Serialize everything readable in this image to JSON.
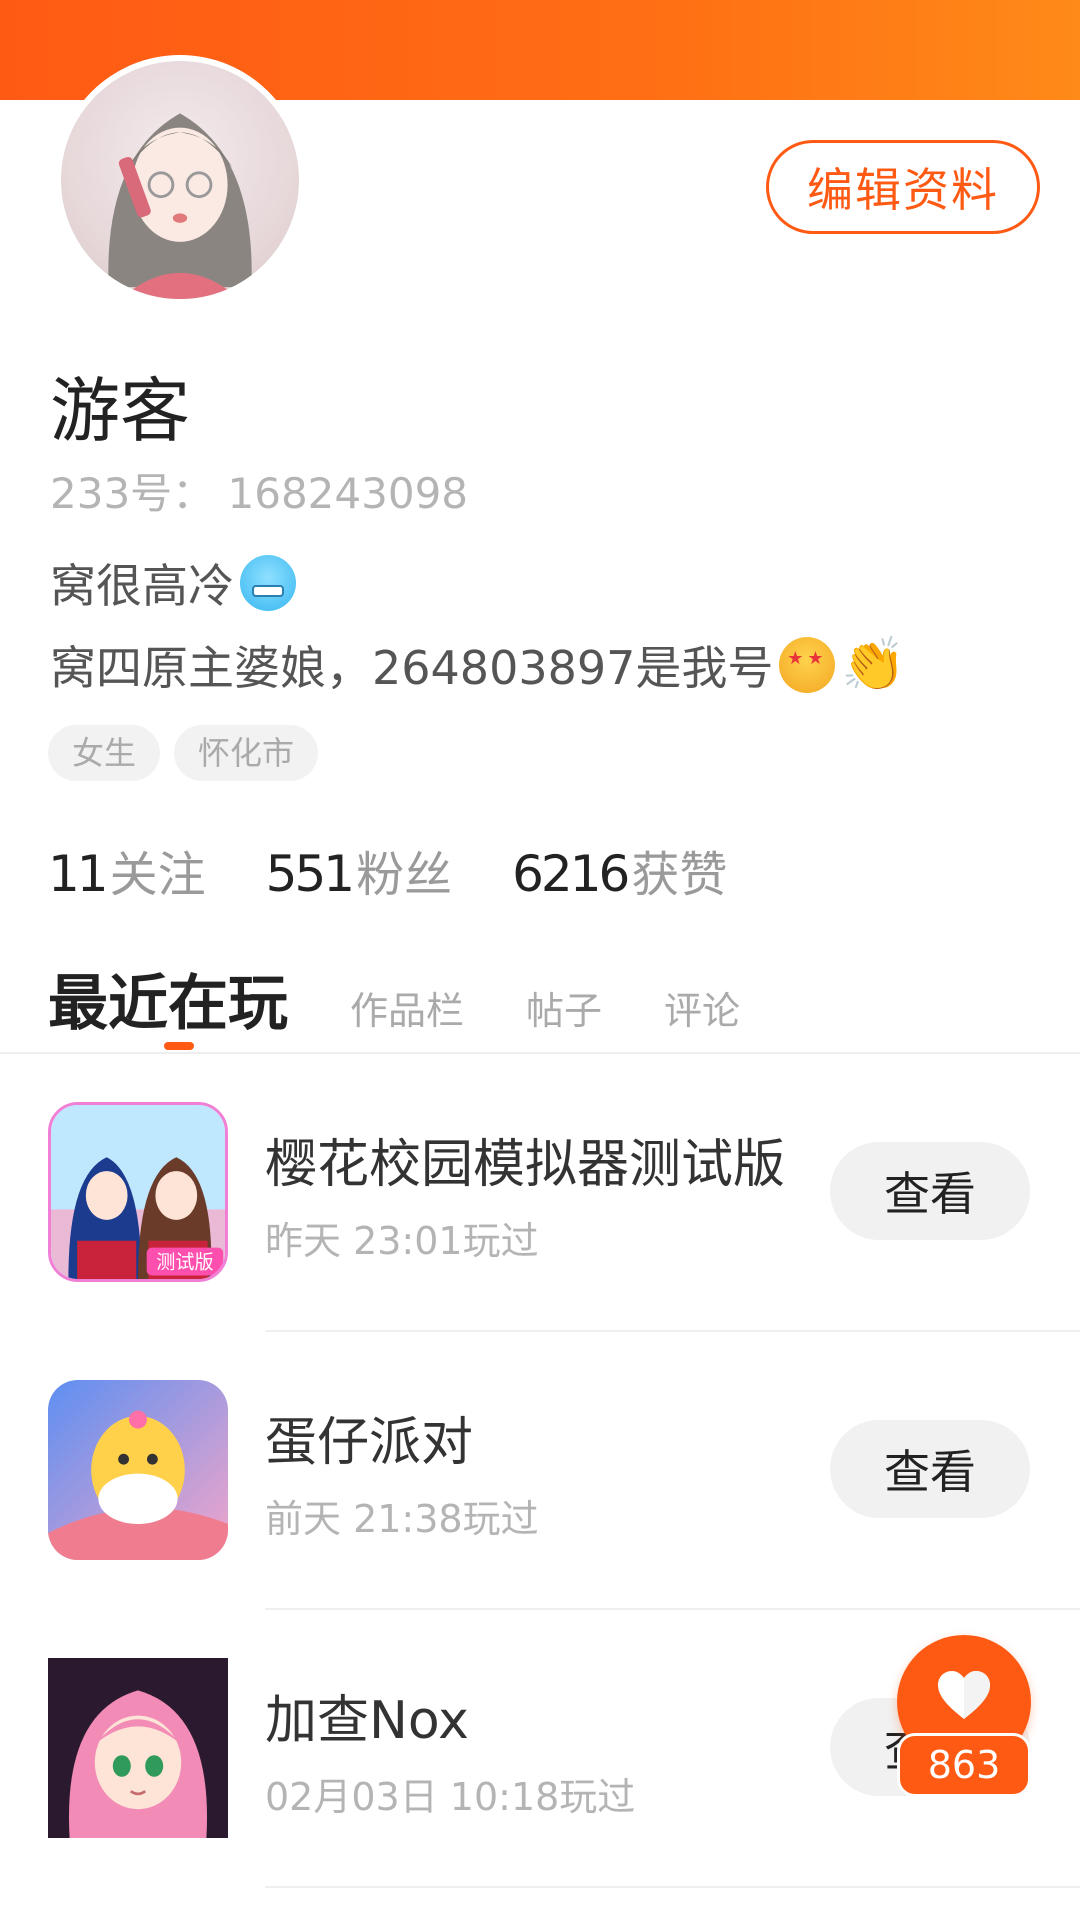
{
  "profile": {
    "edit_label": "编辑资料",
    "username": "游客",
    "user_id": "233号： 168243098",
    "bio_line1": "窝很高冷",
    "bio_line2": "窝四原主婆娘，264803897是我号",
    "tags": [
      "女生",
      "怀化市"
    ],
    "stats": [
      {
        "num": "11",
        "label": "关注"
      },
      {
        "num": "551",
        "label": "粉丝"
      },
      {
        "num": "6216",
        "label": "获赞"
      }
    ]
  },
  "tabs": [
    {
      "label": "最近在玩",
      "active": true
    },
    {
      "label": "作品栏"
    },
    {
      "label": "帖子"
    },
    {
      "label": "评论"
    }
  ],
  "games": [
    {
      "title": "樱花校园模拟器测试版",
      "time": "昨天 23:01玩过",
      "button": "查看",
      "badge": "测试版"
    },
    {
      "title": "蛋仔派对",
      "time": "前天 21:38玩过",
      "button": "查看"
    },
    {
      "title": "加查Nox",
      "time": "02月03日 10:18玩过",
      "button": "查看"
    }
  ],
  "like_count": "863",
  "colors": {
    "accent": "#ff5a14",
    "muted": "#b4b4b4"
  }
}
